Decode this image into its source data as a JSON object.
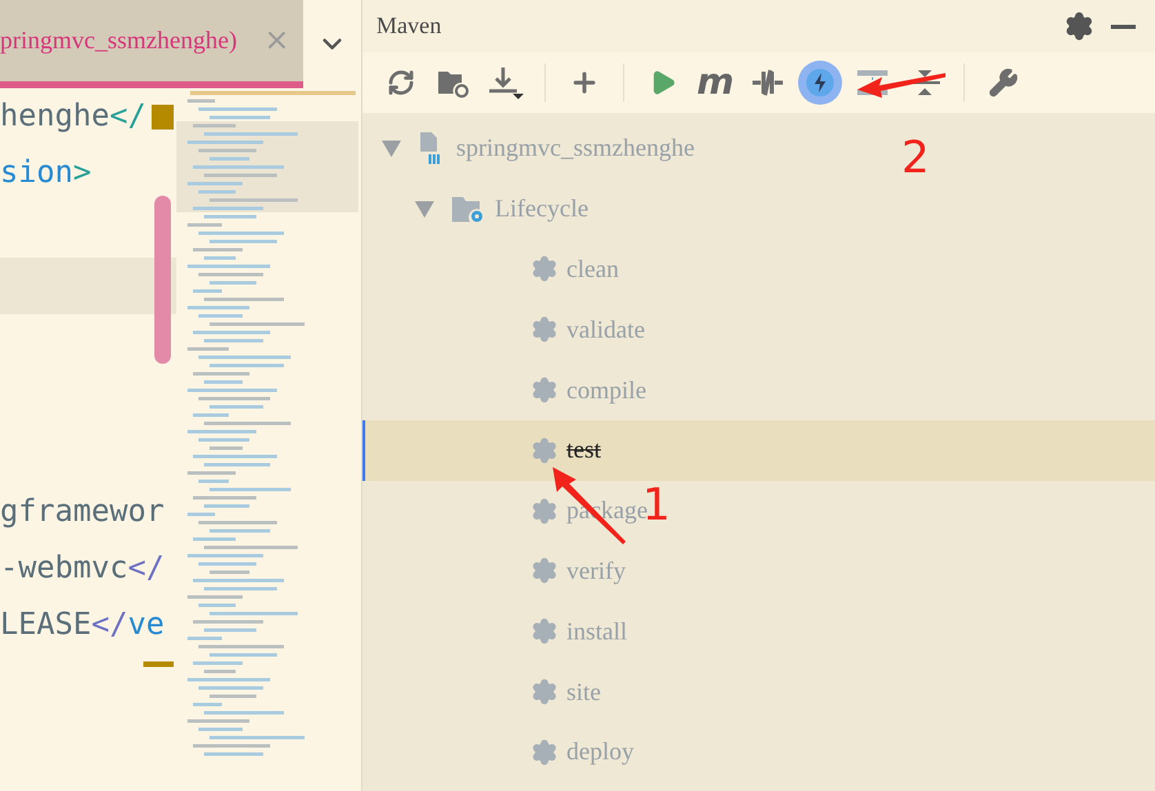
{
  "editor": {
    "tab": {
      "title": "pringmvc_ssmzhenghe)",
      "close": "×"
    },
    "lines": [
      {
        "kind": "code",
        "segments": [
          {
            "kind": "text",
            "text": "henghe"
          },
          {
            "kind": "tag",
            "text": "</"
          }
        ],
        "caret": true
      },
      {
        "kind": "code",
        "segments": [
          {
            "kind": "name",
            "text": "sion"
          },
          {
            "kind": "tag",
            "text": ">"
          }
        ]
      },
      {
        "kind": "blank"
      },
      {
        "kind": "blank",
        "highlighted": true
      },
      {
        "kind": "blank"
      },
      {
        "kind": "blank"
      },
      {
        "kind": "blank"
      },
      {
        "kind": "code",
        "segments": [
          {
            "kind": "text",
            "text": "gframewor"
          }
        ]
      },
      {
        "kind": "code",
        "segments": [
          {
            "kind": "text",
            "text": "-webmvc"
          },
          {
            "kind": "slash",
            "text": "</"
          }
        ]
      },
      {
        "kind": "code",
        "segments": [
          {
            "kind": "text",
            "text": "LEASE"
          },
          {
            "kind": "slash",
            "text": "</"
          },
          {
            "kind": "name",
            "text": "ve"
          }
        ]
      }
    ]
  },
  "maven": {
    "title": "Maven",
    "toolbar": [
      {
        "kind": "reload"
      },
      {
        "kind": "generate"
      },
      {
        "kind": "download"
      },
      {
        "kind": "separator"
      },
      {
        "kind": "add"
      },
      {
        "kind": "separator"
      },
      {
        "kind": "run"
      },
      {
        "kind": "goal",
        "glyph": "m"
      },
      {
        "kind": "offline"
      },
      {
        "kind": "skip-tests",
        "on": true
      },
      {
        "kind": "diagram"
      },
      {
        "kind": "collapse"
      },
      {
        "kind": "separator"
      },
      {
        "kind": "settings"
      }
    ],
    "tree": [
      {
        "label": "springmvc_ssmzhenghe",
        "kind": "project",
        "expanded": true,
        "children": [
          {
            "label": "Lifecycle",
            "kind": "folder",
            "expanded": true,
            "children": [
              {
                "label": "clean",
                "kind": "goal",
                "selected": false,
                "skipped": false
              },
              {
                "label": "validate",
                "kind": "goal",
                "selected": false,
                "skipped": false
              },
              {
                "label": "compile",
                "kind": "goal",
                "selected": false,
                "skipped": false
              },
              {
                "label": "test",
                "kind": "goal",
                "selected": true,
                "skipped": true
              },
              {
                "label": "package",
                "kind": "goal",
                "selected": false,
                "skipped": false
              },
              {
                "label": "verify",
                "kind": "goal",
                "selected": false,
                "skipped": false
              },
              {
                "label": "install",
                "kind": "goal",
                "selected": false,
                "skipped": false
              },
              {
                "label": "site",
                "kind": "goal",
                "selected": false,
                "skipped": false
              },
              {
                "label": "deploy",
                "kind": "goal",
                "selected": false,
                "skipped": false
              }
            ]
          }
        ]
      }
    ]
  },
  "annotations": [
    {
      "text": "2"
    },
    {
      "text": "1"
    }
  ]
}
